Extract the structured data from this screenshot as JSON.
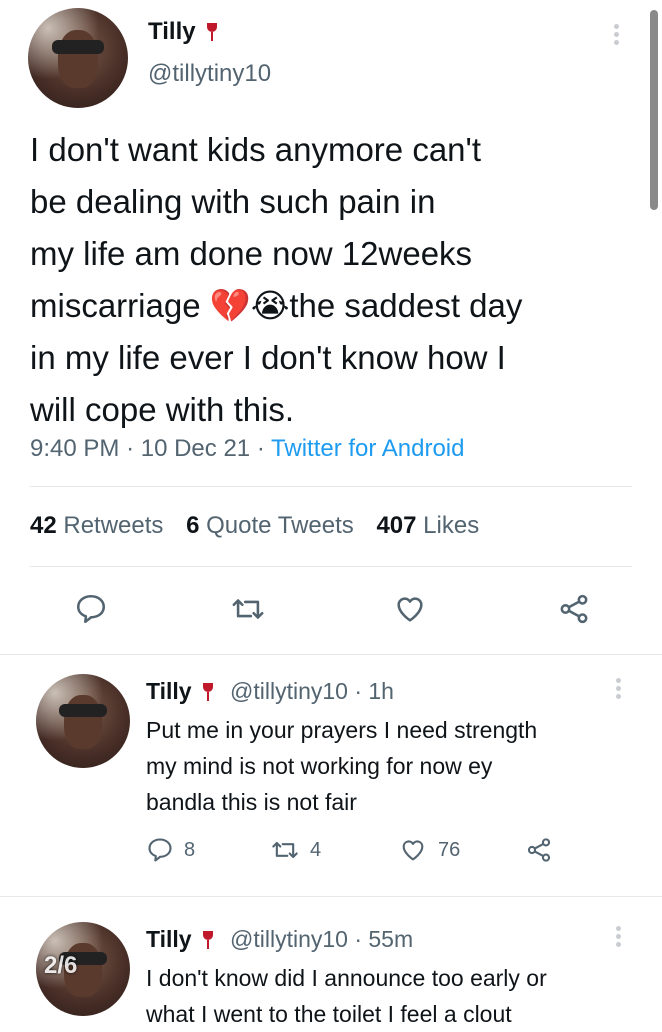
{
  "main_tweet": {
    "name": "Tilly",
    "handle": "@tillytiny10",
    "text_lines": [
      "I don't want kids anymore can't",
      "be dealing with such pain in",
      "my life am done now 12weeks",
      "miscarriage",
      "the saddest day",
      "in my life ever I don't know how I",
      "will cope with this."
    ],
    "emoji_1": "💔",
    "emoji_2": "😭",
    "time": "9:40 PM",
    "date": "10 Dec 21",
    "source": "Twitter for Android",
    "separator": "·",
    "stats": {
      "retweets_count": "42",
      "retweets_label": "Retweets",
      "quotes_count": "6",
      "quotes_label": "Quote Tweets",
      "likes_count": "407",
      "likes_label": "Likes"
    }
  },
  "replies": [
    {
      "name": "Tilly",
      "handle": "@tillytiny10",
      "time": "· 1h",
      "lines": [
        "Put me in your prayers I need strength",
        "my mind is not working for now ey",
        "bandla this is not fair"
      ],
      "reply_count": "8",
      "retweet_count": "4",
      "like_count": "76"
    },
    {
      "name": "Tilly",
      "handle": "@tillytiny10",
      "time": "· 55m",
      "lines": [
        "I don't know did I announce too early or",
        "what I went to the toilet I feel a clout"
      ],
      "overlay": "2/6"
    }
  ],
  "icons": [
    "reply-icon",
    "retweet-icon",
    "like-icon",
    "share-icon",
    "more-icon",
    "wine-glass-icon"
  ]
}
